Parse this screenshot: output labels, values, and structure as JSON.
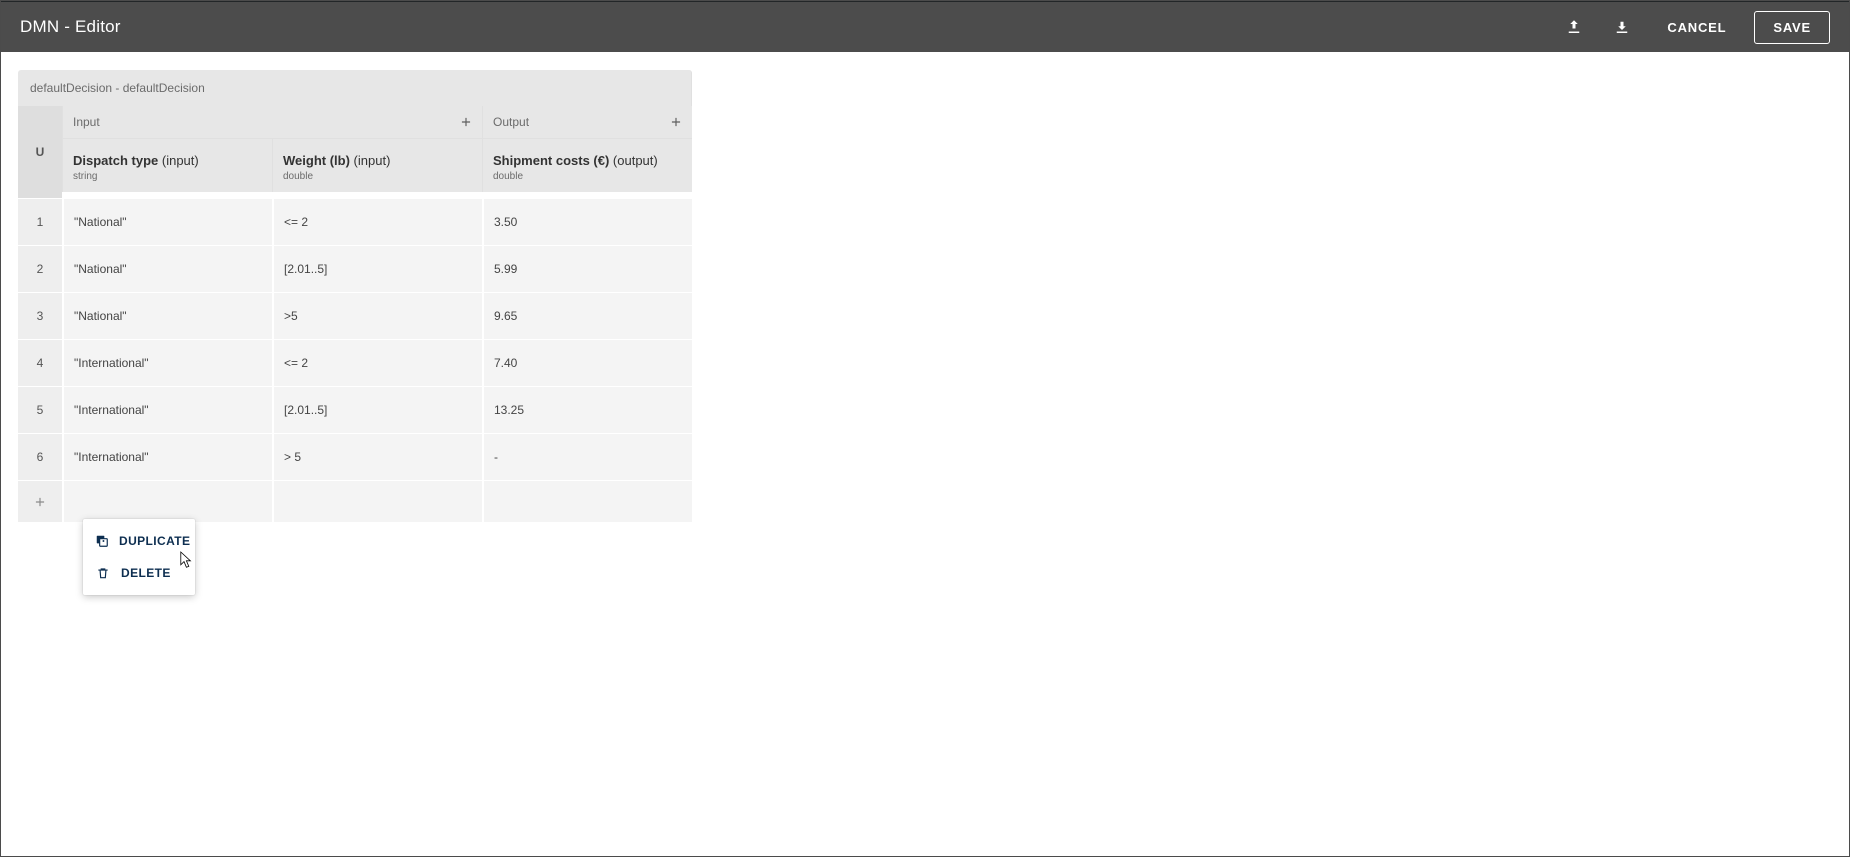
{
  "header": {
    "title": "DMN - Editor",
    "cancel_label": "CANCEL",
    "save_label": "SAVE"
  },
  "decision": {
    "title": "defaultDecision - defaultDecision",
    "hit_policy": "U"
  },
  "groups": {
    "input_label": "Input",
    "output_label": "Output"
  },
  "columns": {
    "inputs": [
      {
        "name": "Dispatch type",
        "suffix": "(input)",
        "type": "string"
      },
      {
        "name": "Weight (lb)",
        "suffix": "(input)",
        "type": "double"
      }
    ],
    "outputs": [
      {
        "name": "Shipment costs (€)",
        "suffix": "(output)",
        "type": "double"
      }
    ]
  },
  "rows": [
    {
      "n": "1",
      "in1": "\"National\"",
      "in2": "<= 2",
      "out1": "3.50"
    },
    {
      "n": "2",
      "in1": "\"National\"",
      "in2": "[2.01..5]",
      "out1": "5.99"
    },
    {
      "n": "3",
      "in1": "\"National\"",
      "in2": ">5",
      "out1": "9.65"
    },
    {
      "n": "4",
      "in1": "\"International\"",
      "in2": "<= 2",
      "out1": "7.40"
    },
    {
      "n": "5",
      "in1": "\"International\"",
      "in2": "[2.01..5]",
      "out1": "13.25"
    },
    {
      "n": "6",
      "in1": "\"International\"",
      "in2": "> 5",
      "out1": "-"
    }
  ],
  "context_menu": {
    "duplicate_label": "DUPLICATE",
    "delete_label": "DELETE"
  }
}
